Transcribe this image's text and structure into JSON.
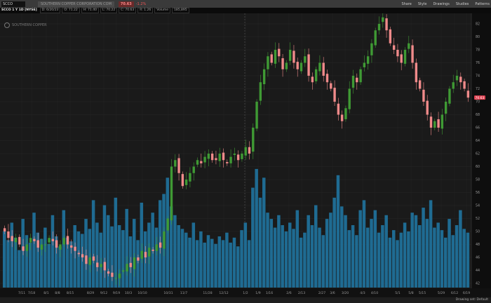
{
  "header": {
    "symbol": "SCCO",
    "company": "SOUTHERN COPPER CORPORATION COM",
    "last_price": "70.63",
    "change": "-1.2%",
    "tools": [
      "Share",
      "Style",
      "Drawings",
      "Studies",
      "Patterns"
    ]
  },
  "infobar": {
    "title": "SCCO 1 Y 1D [NYSE]",
    "fields": [
      "D: 6/20/23",
      "O: 71.22",
      "H: 71.40",
      "L: 70.22",
      "C: 70.63",
      "R: 1.26",
      "Volume",
      "185,895"
    ]
  },
  "logo_text": "SOUTHERN COPPER",
  "status": {
    "drawing_set": "Drawing set: Default"
  },
  "colors": {
    "up": "#3f9a34",
    "down": "#f08a8a",
    "volume": "#1f6b92",
    "background": "#141414",
    "price_tag": "#e04050"
  },
  "chart_data": {
    "type": "candlestick",
    "ylim": [
      42,
      82
    ],
    "y_ticks": [
      82,
      80,
      78,
      76,
      74,
      72,
      70,
      68,
      66,
      64,
      62,
      60,
      58,
      56,
      54,
      52,
      50,
      48,
      46,
      44,
      42
    ],
    "x_ticks": [
      "7/11",
      "7/18",
      "8/1",
      "8/8",
      "8/15",
      "8/29",
      "9/12",
      "9/19",
      "10/3",
      "10/10",
      "10/31",
      "11/7",
      "11/28",
      "12/12",
      "1/2",
      "1/9",
      "1/16",
      "2/6",
      "2/13",
      "2/27",
      "3/6",
      "3/20",
      "4/3",
      "4/10",
      "5/1",
      "5/8",
      "5/15",
      "5/29",
      "6/12",
      "6/19"
    ],
    "last_price_label": "70.63",
    "closes": [
      50,
      49,
      48.5,
      49,
      48,
      47,
      48,
      49,
      48.5,
      47.5,
      48,
      48,
      49,
      48.5,
      47.5,
      48,
      49,
      48,
      47.5,
      47,
      46.5,
      46,
      45,
      46,
      45.5,
      44.5,
      45,
      44,
      43.5,
      43,
      42.8,
      43.5,
      44,
      45,
      44.5,
      46,
      45.5,
      47,
      46,
      47.5,
      47,
      48,
      47.5,
      50,
      52,
      60,
      61,
      59,
      57,
      58,
      59,
      60,
      61,
      60.5,
      61.5,
      62,
      61,
      61,
      62,
      61,
      60.5,
      61.5,
      62,
      61,
      62,
      63,
      62,
      66,
      70,
      73,
      75,
      77,
      76,
      78,
      77,
      75,
      76,
      78,
      76,
      75,
      76,
      77,
      74,
      73,
      75,
      76,
      74,
      73,
      72,
      70,
      68,
      67,
      69,
      72,
      74,
      73,
      75,
      76,
      77,
      79,
      81,
      82,
      83,
      81,
      79,
      78,
      77,
      76,
      78,
      79,
      76,
      73,
      72,
      70,
      68,
      66,
      67,
      66,
      68,
      70,
      72,
      73,
      74,
      73,
      72,
      70.63
    ],
    "volume_relative": [
      45,
      38,
      52,
      40,
      30,
      55,
      42,
      36,
      60,
      44,
      39,
      48,
      35,
      58,
      41,
      33,
      62,
      40,
      37,
      50,
      45,
      43,
      55,
      47,
      70,
      52,
      44,
      66,
      58,
      49,
      72,
      50,
      46,
      63,
      41,
      55,
      38,
      68,
      45,
      52,
      60,
      48,
      70,
      75,
      88,
      65,
      58,
      50,
      47,
      44,
      40,
      52,
      38,
      45,
      36,
      42,
      39,
      35,
      41,
      38,
      44,
      36,
      40,
      33,
      46,
      52,
      38,
      80,
      95,
      72,
      88,
      60,
      55,
      48,
      58,
      50,
      45,
      52,
      47,
      62,
      40,
      44,
      58,
      50,
      66,
      48,
      42,
      55,
      60,
      72,
      90,
      65,
      58,
      46,
      50,
      42,
      62,
      70,
      48,
      55,
      62,
      44,
      50,
      58,
      40,
      46,
      38,
      44,
      52,
      45,
      60,
      58,
      50,
      64,
      55,
      70,
      48,
      52,
      46,
      40,
      55,
      42,
      50,
      62,
      47,
      44
    ]
  }
}
